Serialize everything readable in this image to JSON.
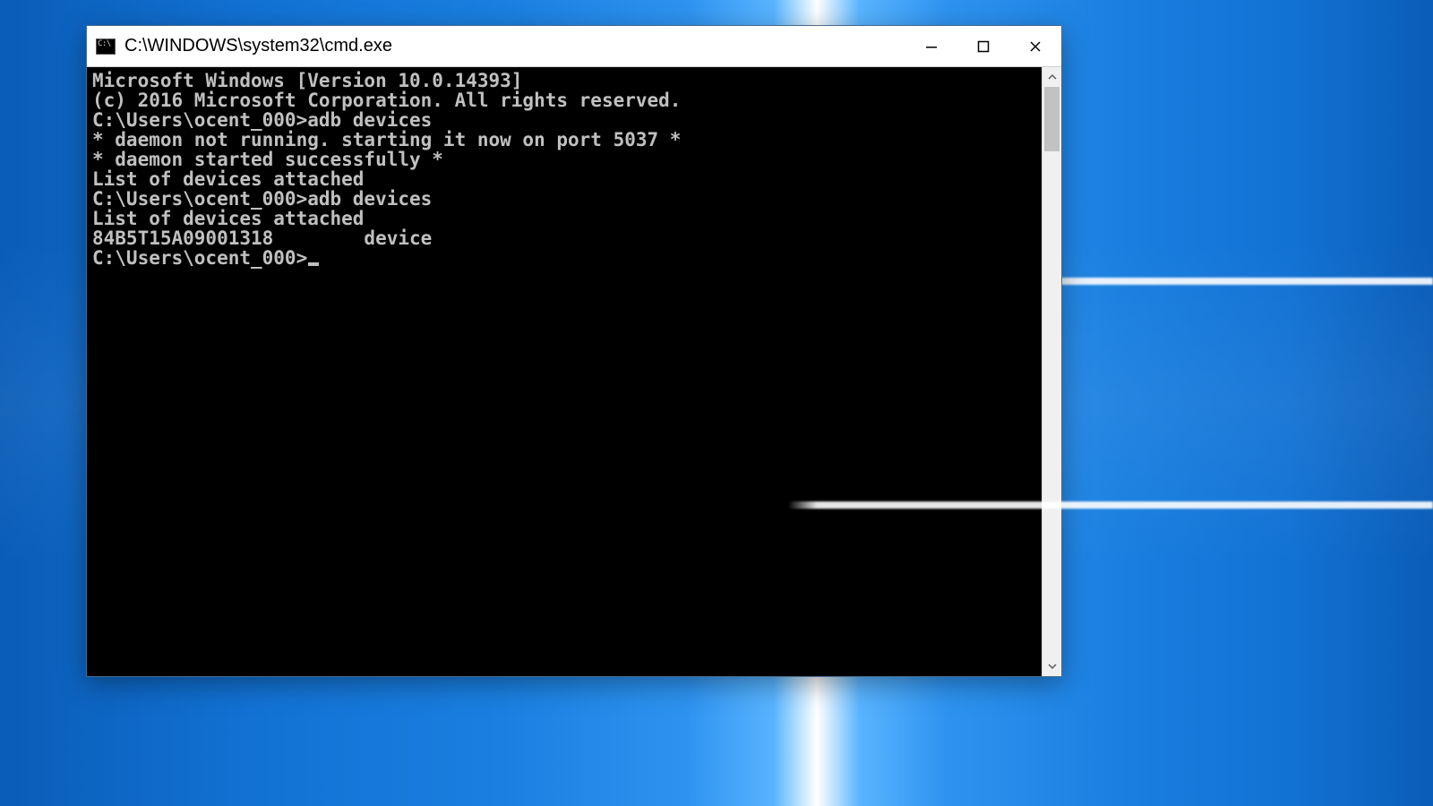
{
  "window": {
    "title": "C:\\WINDOWS\\system32\\cmd.exe"
  },
  "terminal": {
    "lines": [
      "Microsoft Windows [Version 10.0.14393]",
      "(c) 2016 Microsoft Corporation. All rights reserved.",
      "",
      "C:\\Users\\ocent_000>adb devices",
      "* daemon not running. starting it now on port 5037 *",
      "* daemon started successfully *",
      "List of devices attached",
      "",
      "",
      "C:\\Users\\ocent_000>adb devices",
      "List of devices attached",
      "84B5T15A09001318        device",
      "",
      "",
      "C:\\Users\\ocent_000>"
    ],
    "cursor_on_last_line": true
  }
}
